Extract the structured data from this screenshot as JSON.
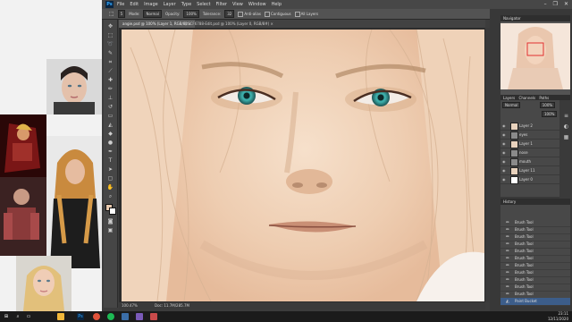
{
  "app": {
    "logo": "Ps",
    "window_controls": [
      "–",
      "❐",
      "✕"
    ]
  },
  "menubar": {
    "items": [
      "File",
      "Edit",
      "Image",
      "Layer",
      "Type",
      "Select",
      "Filter",
      "View",
      "Window",
      "Help"
    ]
  },
  "options": {
    "brush_size": "5",
    "mode_label": "Mode:",
    "mode_value": "Normal",
    "opacity_label": "Opacity:",
    "opacity_value": "100%",
    "tolerance_label": "Tolerance:",
    "tolerance_value": "32",
    "antialias_label": "Anti-alias",
    "contiguous_label": "Contiguous",
    "all_layers_label": "All Layers"
  },
  "document_tabs": [
    {
      "label": "angie.psd @ 100% (Layer 1, RGB/8) ×",
      "active": true
    },
    {
      "label": "DSCF6788-Edit.psd @ 100% (Layer 0, RGB/8#) ×",
      "active": false
    }
  ],
  "statusbar": {
    "zoom": "100.47%",
    "doc": "Doc: 11.7M/285.7M"
  },
  "panels": {
    "navigator": {
      "title": "Navigator"
    },
    "layers": {
      "tabs": [
        "Layers",
        "Channels",
        "Paths"
      ],
      "blend": "Normal",
      "opacity": "100%",
      "fill": "100%",
      "rows": [
        {
          "name": "Layer 2"
        },
        {
          "name": "eyes"
        },
        {
          "name": "Layer 1"
        },
        {
          "name": "nose"
        },
        {
          "name": "mouth"
        },
        {
          "name": "Layer 11"
        },
        {
          "name": "Layer 0"
        }
      ]
    },
    "history": {
      "title": "History",
      "rows": [
        {
          "name": "Brush Tool"
        },
        {
          "name": "Brush Tool"
        },
        {
          "name": "Brush Tool"
        },
        {
          "name": "Brush Tool"
        },
        {
          "name": "Brush Tool"
        },
        {
          "name": "Brush Tool"
        },
        {
          "name": "Brush Tool"
        },
        {
          "name": "Brush Tool"
        },
        {
          "name": "Brush Tool"
        },
        {
          "name": "Brush Tool"
        },
        {
          "name": "Brush Tool"
        },
        {
          "name": "Paint Bucket"
        }
      ]
    }
  },
  "taskbar": {
    "time": "23:11",
    "date": "12/11/2020",
    "apps": [
      {
        "icon": "windows-icon",
        "color": "#1b1b1b"
      },
      {
        "icon": "search-icon",
        "color": "#1b1b1b"
      },
      {
        "icon": "folder-icon",
        "color": "#f1b73a"
      },
      {
        "icon": "photoshop-icon",
        "color": "#0b2540"
      },
      {
        "icon": "chrome-icon",
        "color": "#e0533b"
      },
      {
        "icon": "spotify-icon",
        "color": "#1db954"
      },
      {
        "icon": "app-icon",
        "color": "#3b6ea8"
      },
      {
        "icon": "app-icon",
        "color": "#7a5ab8"
      },
      {
        "icon": "app-icon",
        "color": "#c94a4a"
      }
    ]
  },
  "colors": {
    "skin": "#f2d7bf",
    "eye": "#3fb2ad",
    "accent": "#3c5d8a"
  }
}
